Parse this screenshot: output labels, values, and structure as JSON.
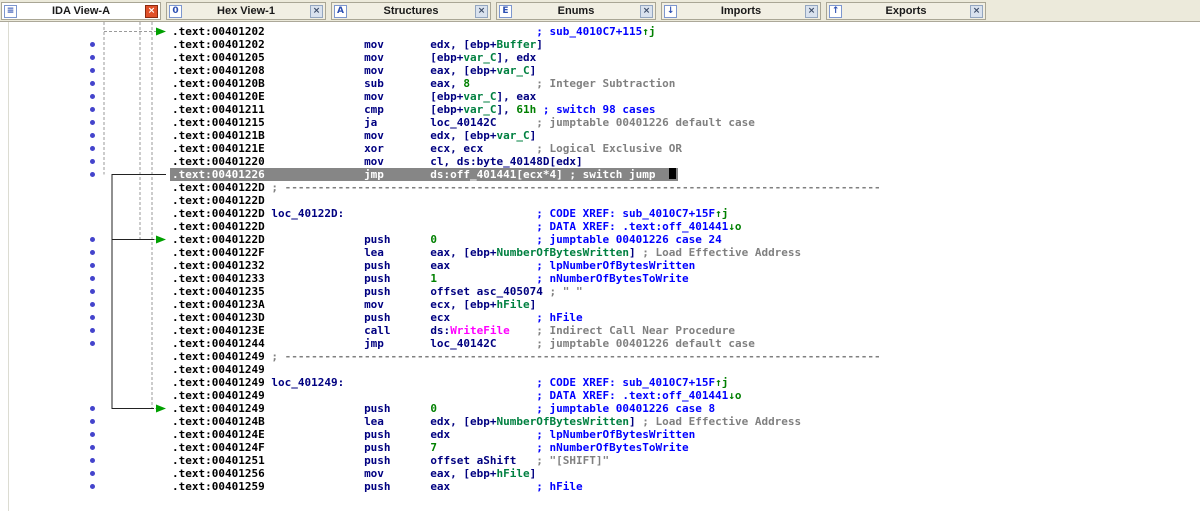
{
  "tabbar": {
    "close_glyph": "×",
    "tabs": [
      {
        "id": "ida-view-a",
        "label": "IDA View-A",
        "icon": "ida-view-icon",
        "glyph": "≡",
        "active": true
      },
      {
        "id": "hex-view-1",
        "label": "Hex View-1",
        "icon": "hex-view-icon",
        "glyph": "0",
        "active": false
      },
      {
        "id": "structures",
        "label": "Structures",
        "icon": "structures-icon",
        "glyph": "A",
        "active": false
      },
      {
        "id": "enums",
        "label": "Enums",
        "icon": "enums-icon",
        "glyph": "E",
        "active": false
      },
      {
        "id": "imports",
        "label": "Imports",
        "icon": "imports-icon",
        "glyph": "↓",
        "active": false
      },
      {
        "id": "exports",
        "label": "Exports",
        "icon": "exports-icon",
        "glyph": "↑",
        "active": false
      }
    ]
  },
  "palette": {
    "address": "#000000",
    "code": "#000080",
    "stack_var": "#008040",
    "number": "#008000",
    "auto_comment": "#808080",
    "named_comment": "#0000ff",
    "import_name": "#ff00ff",
    "xref_arrow": "#008000",
    "selection_bg": "#868686",
    "dot": "#4444cc",
    "tabbar_bg": "#eceadb",
    "close_active": "#e0502a"
  },
  "listing": {
    "lines": [
      {
        "segs": [
          [
            "a",
            ".text:00401202"
          ],
          [
            "p",
            41
          ],
          [
            "cb",
            "; sub_4010C7+115"
          ],
          [
            "xg",
            "↑j"
          ]
        ]
      },
      {
        "dot": true,
        "segs": [
          [
            "a",
            ".text:00401202"
          ],
          [
            "p",
            15
          ],
          [
            "m",
            "mov"
          ],
          [
            "p",
            7
          ],
          [
            "i",
            "edx, [ebp+"
          ],
          [
            "v",
            "Buffer"
          ],
          [
            "i",
            "]"
          ]
        ]
      },
      {
        "dot": true,
        "segs": [
          [
            "a",
            ".text:00401205"
          ],
          [
            "p",
            15
          ],
          [
            "m",
            "mov"
          ],
          [
            "p",
            7
          ],
          [
            "i",
            "[ebp+"
          ],
          [
            "v",
            "var_C"
          ],
          [
            "i",
            "], edx"
          ]
        ]
      },
      {
        "dot": true,
        "segs": [
          [
            "a",
            ".text:00401208"
          ],
          [
            "p",
            15
          ],
          [
            "m",
            "mov"
          ],
          [
            "p",
            7
          ],
          [
            "i",
            "eax, [ebp+"
          ],
          [
            "v",
            "var_C"
          ],
          [
            "i",
            "]"
          ]
        ]
      },
      {
        "dot": true,
        "segs": [
          [
            "a",
            ".text:0040120B"
          ],
          [
            "p",
            15
          ],
          [
            "m",
            "sub"
          ],
          [
            "p",
            7
          ],
          [
            "i",
            "eax, "
          ],
          [
            "n",
            "8"
          ],
          [
            "p",
            10
          ],
          [
            "cg",
            "; Integer Subtraction"
          ]
        ]
      },
      {
        "dot": true,
        "segs": [
          [
            "a",
            ".text:0040120E"
          ],
          [
            "p",
            15
          ],
          [
            "m",
            "mov"
          ],
          [
            "p",
            7
          ],
          [
            "i",
            "[ebp+"
          ],
          [
            "v",
            "var_C"
          ],
          [
            "i",
            "], eax"
          ]
        ]
      },
      {
        "dot": true,
        "segs": [
          [
            "a",
            ".text:00401211"
          ],
          [
            "p",
            15
          ],
          [
            "m",
            "cmp"
          ],
          [
            "p",
            7
          ],
          [
            "i",
            "[ebp+"
          ],
          [
            "v",
            "var_C"
          ],
          [
            "i",
            "], "
          ],
          [
            "n",
            "61h"
          ],
          [
            "p",
            1
          ],
          [
            "cb",
            "; switch 98 cases"
          ]
        ]
      },
      {
        "dot": true,
        "segs": [
          [
            "a",
            ".text:00401215"
          ],
          [
            "p",
            15
          ],
          [
            "m",
            "ja"
          ],
          [
            "p",
            8
          ],
          [
            "i",
            "loc_40142C"
          ],
          [
            "p",
            6
          ],
          [
            "cg",
            "; jumptable 00401226 default case"
          ]
        ]
      },
      {
        "dot": true,
        "segs": [
          [
            "a",
            ".text:0040121B"
          ],
          [
            "p",
            15
          ],
          [
            "m",
            "mov"
          ],
          [
            "p",
            7
          ],
          [
            "i",
            "edx, [ebp+"
          ],
          [
            "v",
            "var_C"
          ],
          [
            "i",
            "]"
          ]
        ]
      },
      {
        "dot": true,
        "segs": [
          [
            "a",
            ".text:0040121E"
          ],
          [
            "p",
            15
          ],
          [
            "m",
            "xor"
          ],
          [
            "p",
            7
          ],
          [
            "i",
            "ecx, ecx"
          ],
          [
            "p",
            8
          ],
          [
            "cg",
            "; Logical Exclusive OR"
          ]
        ]
      },
      {
        "dot": true,
        "segs": [
          [
            "a",
            ".text:00401220"
          ],
          [
            "p",
            15
          ],
          [
            "m",
            "mov"
          ],
          [
            "p",
            7
          ],
          [
            "i",
            "cl, ds:byte_40148D[edx]"
          ]
        ]
      },
      {
        "dot": true,
        "sel": true,
        "cursor": true,
        "segs": [
          [
            "a",
            ".text:00401226"
          ],
          [
            "p",
            15
          ],
          [
            "m",
            "jmp"
          ],
          [
            "p",
            7
          ],
          [
            "i",
            "ds:off_401441[ecx*4]"
          ],
          [
            "p",
            1
          ],
          [
            "cg",
            "; switch jump"
          ]
        ]
      },
      {
        "segs": [
          [
            "a",
            ".text:0040122D"
          ],
          [
            "p",
            1
          ],
          [
            "sep",
            "; ------------------------------------------------------------------------------------------"
          ]
        ]
      },
      {
        "segs": [
          [
            "a",
            ".text:0040122D"
          ]
        ]
      },
      {
        "segs": [
          [
            "a",
            ".text:0040122D"
          ],
          [
            "p",
            1
          ],
          [
            "lbl",
            "loc_40122D:"
          ],
          [
            "p",
            29
          ],
          [
            "cb",
            "; CODE XREF: sub_4010C7+15F"
          ],
          [
            "xg",
            "↑j"
          ]
        ]
      },
      {
        "segs": [
          [
            "a",
            ".text:0040122D"
          ],
          [
            "p",
            41
          ],
          [
            "cb",
            "; DATA XREF: .text:off_401441"
          ],
          [
            "xg",
            "↓o"
          ]
        ]
      },
      {
        "dot": true,
        "segs": [
          [
            "a",
            ".text:0040122D"
          ],
          [
            "p",
            15
          ],
          [
            "m",
            "push"
          ],
          [
            "p",
            6
          ],
          [
            "n",
            "0"
          ],
          [
            "p",
            15
          ],
          [
            "cb",
            "; jumptable 00401226 case 24"
          ]
        ]
      },
      {
        "dot": true,
        "segs": [
          [
            "a",
            ".text:0040122F"
          ],
          [
            "p",
            15
          ],
          [
            "m",
            "lea"
          ],
          [
            "p",
            7
          ],
          [
            "i",
            "eax, [ebp+"
          ],
          [
            "v",
            "NumberOfBytesWritten"
          ],
          [
            "i",
            "]"
          ],
          [
            "p",
            1
          ],
          [
            "cg",
            "; Load Effective Address"
          ]
        ]
      },
      {
        "dot": true,
        "segs": [
          [
            "a",
            ".text:00401232"
          ],
          [
            "p",
            15
          ],
          [
            "m",
            "push"
          ],
          [
            "p",
            6
          ],
          [
            "i",
            "eax"
          ],
          [
            "p",
            13
          ],
          [
            "cb",
            "; lpNumberOfBytesWritten"
          ]
        ]
      },
      {
        "dot": true,
        "segs": [
          [
            "a",
            ".text:00401233"
          ],
          [
            "p",
            15
          ],
          [
            "m",
            "push"
          ],
          [
            "p",
            6
          ],
          [
            "n",
            "1"
          ],
          [
            "p",
            15
          ],
          [
            "cb",
            "; nNumberOfBytesToWrite"
          ]
        ]
      },
      {
        "dot": true,
        "segs": [
          [
            "a",
            ".text:00401235"
          ],
          [
            "p",
            15
          ],
          [
            "m",
            "push"
          ],
          [
            "p",
            6
          ],
          [
            "i",
            "offset asc_405074"
          ],
          [
            "p",
            1
          ],
          [
            "cg",
            "; \" \""
          ]
        ]
      },
      {
        "dot": true,
        "segs": [
          [
            "a",
            ".text:0040123A"
          ],
          [
            "p",
            15
          ],
          [
            "m",
            "mov"
          ],
          [
            "p",
            7
          ],
          [
            "i",
            "ecx, [ebp+"
          ],
          [
            "v",
            "hFile"
          ],
          [
            "i",
            "]"
          ]
        ]
      },
      {
        "dot": true,
        "segs": [
          [
            "a",
            ".text:0040123D"
          ],
          [
            "p",
            15
          ],
          [
            "m",
            "push"
          ],
          [
            "p",
            6
          ],
          [
            "i",
            "ecx"
          ],
          [
            "p",
            13
          ],
          [
            "cb",
            "; hFile"
          ]
        ]
      },
      {
        "dot": true,
        "segs": [
          [
            "a",
            ".text:0040123E"
          ],
          [
            "p",
            15
          ],
          [
            "m",
            "call"
          ],
          [
            "p",
            6
          ],
          [
            "i",
            "ds:"
          ],
          [
            "imp",
            "WriteFile"
          ],
          [
            "p",
            4
          ],
          [
            "cg",
            "; Indirect Call Near Procedure"
          ]
        ]
      },
      {
        "dot": true,
        "segs": [
          [
            "a",
            ".text:00401244"
          ],
          [
            "p",
            15
          ],
          [
            "m",
            "jmp"
          ],
          [
            "p",
            7
          ],
          [
            "i",
            "loc_40142C"
          ],
          [
            "p",
            6
          ],
          [
            "cg",
            "; jumptable 00401226 default case"
          ]
        ]
      },
      {
        "segs": [
          [
            "a",
            ".text:00401249"
          ],
          [
            "p",
            1
          ],
          [
            "sep",
            "; ------------------------------------------------------------------------------------------"
          ]
        ]
      },
      {
        "segs": [
          [
            "a",
            ".text:00401249"
          ]
        ]
      },
      {
        "segs": [
          [
            "a",
            ".text:00401249"
          ],
          [
            "p",
            1
          ],
          [
            "lbl",
            "loc_401249:"
          ],
          [
            "p",
            29
          ],
          [
            "cb",
            "; CODE XREF: sub_4010C7+15F"
          ],
          [
            "xg",
            "↑j"
          ]
        ]
      },
      {
        "segs": [
          [
            "a",
            ".text:00401249"
          ],
          [
            "p",
            41
          ],
          [
            "cb",
            "; DATA XREF: .text:off_401441"
          ],
          [
            "xg",
            "↓o"
          ]
        ]
      },
      {
        "dot": true,
        "segs": [
          [
            "a",
            ".text:00401249"
          ],
          [
            "p",
            15
          ],
          [
            "m",
            "push"
          ],
          [
            "p",
            6
          ],
          [
            "n",
            "0"
          ],
          [
            "p",
            15
          ],
          [
            "cb",
            "; jumptable 00401226 case 8"
          ]
        ]
      },
      {
        "dot": true,
        "segs": [
          [
            "a",
            ".text:0040124B"
          ],
          [
            "p",
            15
          ],
          [
            "m",
            "lea"
          ],
          [
            "p",
            7
          ],
          [
            "i",
            "edx, [ebp+"
          ],
          [
            "v",
            "NumberOfBytesWritten"
          ],
          [
            "i",
            "]"
          ],
          [
            "p",
            1
          ],
          [
            "cg",
            "; Load Effective Address"
          ]
        ]
      },
      {
        "dot": true,
        "segs": [
          [
            "a",
            ".text:0040124E"
          ],
          [
            "p",
            15
          ],
          [
            "m",
            "push"
          ],
          [
            "p",
            6
          ],
          [
            "i",
            "edx"
          ],
          [
            "p",
            13
          ],
          [
            "cb",
            "; lpNumberOfBytesWritten"
          ]
        ]
      },
      {
        "dot": true,
        "segs": [
          [
            "a",
            ".text:0040124F"
          ],
          [
            "p",
            15
          ],
          [
            "m",
            "push"
          ],
          [
            "p",
            6
          ],
          [
            "n",
            "7"
          ],
          [
            "p",
            15
          ],
          [
            "cb",
            "; nNumberOfBytesToWrite"
          ]
        ]
      },
      {
        "dot": true,
        "segs": [
          [
            "a",
            ".text:00401251"
          ],
          [
            "p",
            15
          ],
          [
            "m",
            "push"
          ],
          [
            "p",
            6
          ],
          [
            "i",
            "offset aShift"
          ],
          [
            "p",
            3
          ],
          [
            "cg",
            "; \"[SHIFT]\""
          ]
        ]
      },
      {
        "dot": true,
        "segs": [
          [
            "a",
            ".text:00401256"
          ],
          [
            "p",
            15
          ],
          [
            "m",
            "mov"
          ],
          [
            "p",
            7
          ],
          [
            "i",
            "eax, [ebp+"
          ],
          [
            "v",
            "hFile"
          ],
          [
            "i",
            "]"
          ]
        ]
      },
      {
        "dot": true,
        "segs": [
          [
            "a",
            ".text:00401259"
          ],
          [
            "p",
            15
          ],
          [
            "m",
            "push"
          ],
          [
            "p",
            6
          ],
          [
            "i",
            "eax"
          ],
          [
            "p",
            13
          ],
          [
            "cb",
            "; hFile"
          ]
        ]
      }
    ]
  }
}
